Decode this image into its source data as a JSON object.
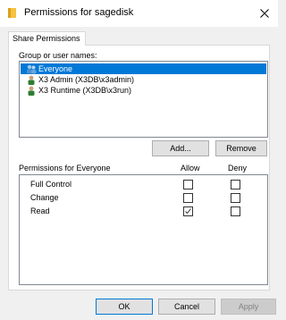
{
  "window": {
    "title": "Permissions for sagedisk"
  },
  "tabs": [
    {
      "label": "Share Permissions"
    }
  ],
  "group_section": {
    "label": "Group or user names:",
    "users": [
      {
        "name": "Everyone",
        "selected": true
      },
      {
        "name": "X3 Admin (X3DB\\x3admin)",
        "selected": false
      },
      {
        "name": "X3 Runtime (X3DB\\x3run)",
        "selected": false
      }
    ],
    "add_label": "Add...",
    "remove_label": "Remove"
  },
  "permissions": {
    "heading": "Permissions for Everyone",
    "allow_header": "Allow",
    "deny_header": "Deny",
    "rows": [
      {
        "name": "Full Control",
        "allow": false,
        "deny": false
      },
      {
        "name": "Change",
        "allow": false,
        "deny": false
      },
      {
        "name": "Read",
        "allow": true,
        "deny": false
      }
    ]
  },
  "footer": {
    "ok_label": "OK",
    "cancel_label": "Cancel",
    "apply_label": "Apply"
  },
  "colors": {
    "selection": "#0078d7",
    "folder": "#f5c242",
    "user_green": "#2e7d32"
  }
}
